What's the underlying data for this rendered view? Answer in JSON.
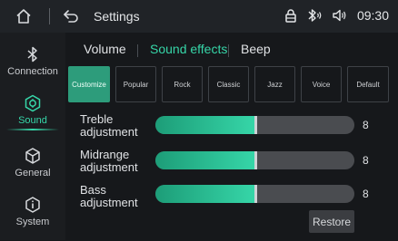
{
  "topbar": {
    "title": "Settings",
    "time": "09:30",
    "icons": [
      "home-icon",
      "back-icon",
      "lock-icon",
      "bluetooth-audio-icon",
      "volume-icon"
    ]
  },
  "sidebar": {
    "items": [
      {
        "label": "Connection",
        "icon": "bluetooth-icon",
        "active": false
      },
      {
        "label": "Sound",
        "icon": "sound-icon",
        "active": true
      },
      {
        "label": "General",
        "icon": "cube-icon",
        "active": false
      },
      {
        "label": "System",
        "icon": "info-icon",
        "active": false
      }
    ]
  },
  "tabs": [
    {
      "label": "Volume",
      "active": false
    },
    {
      "label": "Sound effects",
      "active": true
    },
    {
      "label": "Beep",
      "active": false
    }
  ],
  "presets": [
    {
      "label": "Customize",
      "active": true
    },
    {
      "label": "Popular",
      "active": false
    },
    {
      "label": "Rock",
      "active": false
    },
    {
      "label": "Classic",
      "active": false
    },
    {
      "label": "Jazz",
      "active": false
    },
    {
      "label": "Voice",
      "active": false
    },
    {
      "label": "Default",
      "active": false
    }
  ],
  "adjustments": [
    {
      "label_line1": "Treble",
      "label_line2": "adjustment",
      "value": "8",
      "level": 0.5
    },
    {
      "label_line1": "Midrange",
      "label_line2": "adjustment",
      "value": "8",
      "level": 0.5
    },
    {
      "label_line1": "Bass",
      "label_line2": "adjustment",
      "value": "8",
      "level": 0.5
    }
  ],
  "restore_label": "Restore",
  "colors": {
    "accent": "#36d6a8",
    "background": "#16181b",
    "topbar": "#202327"
  }
}
